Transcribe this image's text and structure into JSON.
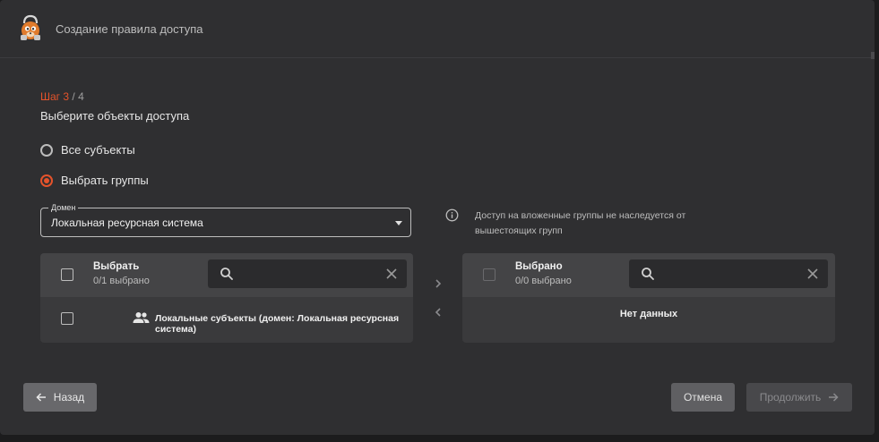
{
  "header": {
    "title": "Создание правила доступа"
  },
  "step": {
    "current": "Шаг 3",
    "separator": " / ",
    "total": "4"
  },
  "heading": "Выберите объекты доступа",
  "options": [
    {
      "label": "Все субъекты",
      "selected": false
    },
    {
      "label": "Выбрать группы",
      "selected": true
    }
  ],
  "domain_select": {
    "legend": "Домен",
    "value": "Локальная ресурсная система"
  },
  "info": {
    "icon": "info-icon",
    "text": "Доступ на вложенные группы не наследуется от вышестоящих групп"
  },
  "left_panel": {
    "title": "Выбрать",
    "count": "0/1 выбрано",
    "search_placeholder": "",
    "items": [
      {
        "label": "Локальные субъекты (домен: Локальная ресурсная система)",
        "icon": "group-icon"
      }
    ]
  },
  "right_panel": {
    "title": "Выбрано",
    "count": "0/0 выбрано",
    "search_placeholder": "",
    "empty_text": "Нет данных"
  },
  "footer": {
    "back_label": "Назад",
    "cancel_label": "Отмена",
    "next_label": "Продолжить"
  },
  "colors": {
    "accent": "#e5532b",
    "background": "#2f2f31",
    "panel": "#3a3a3c"
  }
}
